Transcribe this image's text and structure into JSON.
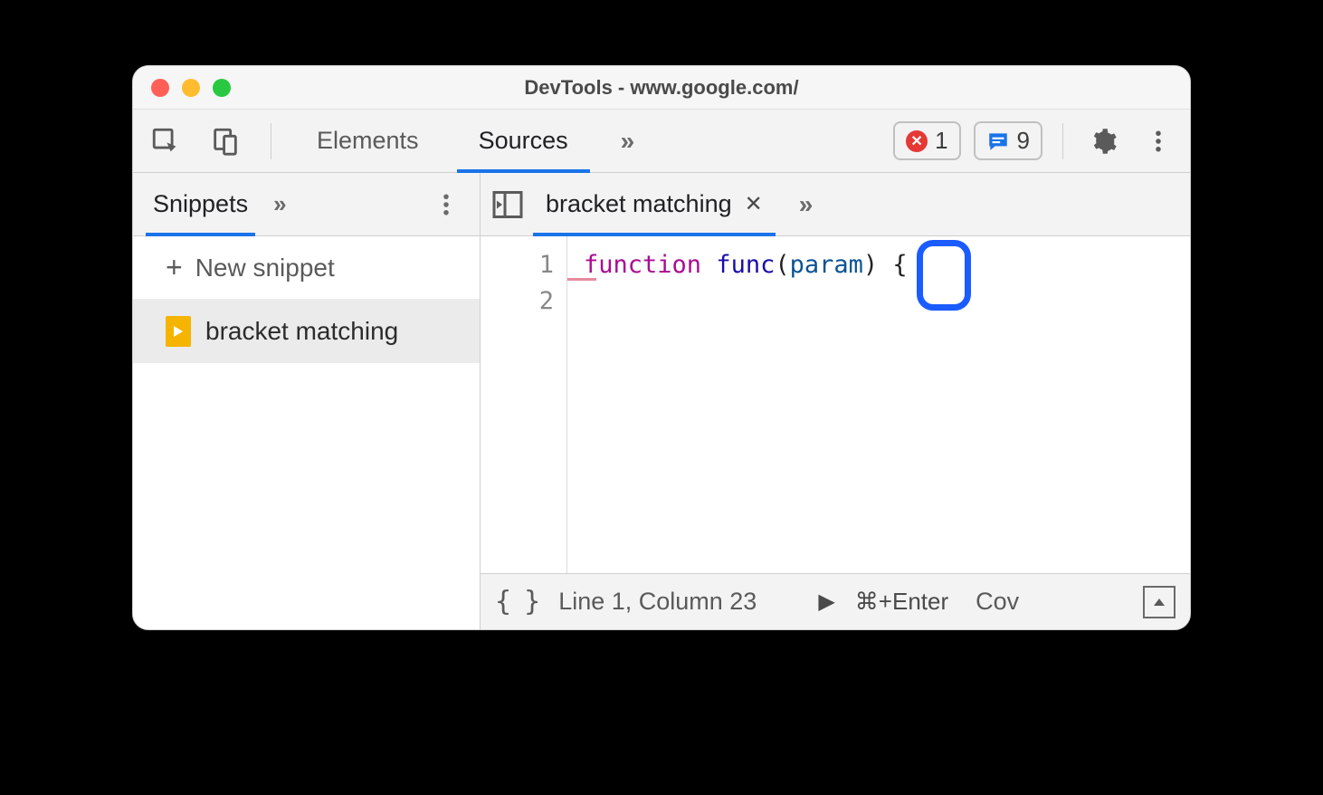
{
  "window": {
    "title": "DevTools - www.google.com/"
  },
  "toolbar": {
    "tabs": {
      "elements": "Elements",
      "sources": "Sources",
      "more": "»"
    },
    "errors_count": "1",
    "messages_count": "9"
  },
  "left": {
    "tab_label": "Snippets",
    "more": "»",
    "new_snippet_label": "New snippet",
    "snippet_name": "bracket matching"
  },
  "editor": {
    "tab_name": "bracket matching",
    "tab_close": "✕",
    "more": "»",
    "line_numbers": [
      "1",
      "2"
    ],
    "code": {
      "keyword": "function",
      "func_name": "func",
      "param": "param",
      "open_paren": "(",
      "close_paren": ")",
      "open_brace": "{"
    }
  },
  "status": {
    "pretty": "{ }",
    "cursor": "Line 1, Column 23",
    "run_glyph": "▶",
    "run_kbd": "⌘+Enter",
    "coverage": "Cov"
  }
}
